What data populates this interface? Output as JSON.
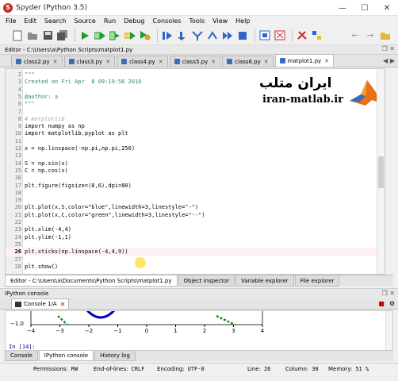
{
  "window": {
    "title": "Spyder (Python 3.5)"
  },
  "window_controls": {
    "minimize": "—",
    "maximize": "☐",
    "close": "✕"
  },
  "menu": [
    "File",
    "Edit",
    "Search",
    "Source",
    "Run",
    "Debug",
    "Consoles",
    "Tools",
    "View",
    "Help"
  ],
  "toolbar_icons": [
    "new-file-icon",
    "open-file-icon",
    "save-icon",
    "save-all-icon",
    "run-icon",
    "run-cell-icon",
    "run-cell-advance-icon",
    "run-selection-icon",
    "run-config-icon",
    "debug-icon",
    "step-icon",
    "step-into-icon",
    "step-return-icon",
    "continue-icon",
    "stop-debug-icon",
    "maximize-pane-icon",
    "fullscreen-icon",
    "preferences-icon",
    "python-path-icon",
    "back-icon",
    "forward-icon",
    "browse-folder-icon"
  ],
  "editor": {
    "title": "Editor - C:\\Users\\a\\Python Scripts\\matplot1.py",
    "tabs": [
      {
        "label": "class2.py",
        "active": false
      },
      {
        "label": "class3.py",
        "active": false
      },
      {
        "label": "class4.py",
        "active": false
      },
      {
        "label": "class5.py",
        "active": false
      },
      {
        "label": "class6.py",
        "active": false
      },
      {
        "label": "matplot1.py",
        "active": true
      }
    ],
    "current_line": 26,
    "lines": [
      {
        "n": "2",
        "t": "\"\"\"",
        "cls": "c-str"
      },
      {
        "n": "3",
        "t": "Created on Fri Apr  8 09:19:56 2016",
        "cls": "c-str"
      },
      {
        "n": "4",
        "t": "",
        "cls": "c-str"
      },
      {
        "n": "5",
        "t": "@author: a",
        "cls": "c-str"
      },
      {
        "n": "6",
        "t": "\"\"\"",
        "cls": "c-str"
      },
      {
        "n": "7",
        "t": "",
        "cls": "c-def"
      },
      {
        "n": "8",
        "t": "# matplotlib",
        "cls": "c-cmt"
      },
      {
        "n": "9",
        "t": "import numpy as np",
        "cls": "c-def"
      },
      {
        "n": "10",
        "t": "import matplotlib.pyplot as plt",
        "cls": "c-def"
      },
      {
        "n": "11",
        "t": "",
        "cls": "c-def"
      },
      {
        "n": "12",
        "t": "x = np.linspace(-np.pi,np.pi,256)",
        "cls": "c-def"
      },
      {
        "n": "13",
        "t": "",
        "cls": "c-def"
      },
      {
        "n": "14",
        "t": "S = np.sin(x)",
        "cls": "c-def"
      },
      {
        "n": "15",
        "t": "C = np.cos(x)",
        "cls": "c-def"
      },
      {
        "n": "16",
        "t": "",
        "cls": "c-def"
      },
      {
        "n": "17",
        "t": "plt.figure(figsize=(8,6),dpi=80)",
        "cls": "c-def"
      },
      {
        "n": "18",
        "t": "",
        "cls": "c-def"
      },
      {
        "n": "19",
        "t": "",
        "cls": "c-def"
      },
      {
        "n": "20",
        "t": "plt.plot(x,S,color=\"blue\",linewidth=3,linestyle=\"-\")",
        "cls": "c-def"
      },
      {
        "n": "21",
        "t": "plt.plot(x,C,color=\"green\",linewidth=3,linestyle=\"--\")",
        "cls": "c-def"
      },
      {
        "n": "22",
        "t": "",
        "cls": "c-def"
      },
      {
        "n": "23",
        "t": "plt.xlim(-4,4)",
        "cls": "c-def"
      },
      {
        "n": "24",
        "t": "plt.ylim(-1,1)",
        "cls": "c-def"
      },
      {
        "n": "25",
        "t": "",
        "cls": "c-def"
      },
      {
        "n": "26",
        "t": "plt.xticks(np.linspace(-4,4,9))",
        "cls": "c-def"
      },
      {
        "n": "27",
        "t": "",
        "cls": "c-def"
      },
      {
        "n": "28",
        "t": "plt.show()",
        "cls": "c-def"
      }
    ]
  },
  "watermark": {
    "fa": "ایران متلب",
    "url": "iran-matlab.ir"
  },
  "bottom_tabs": [
    {
      "label": "Editor - C:\\Users\\a\\Documents\\Python Scripts\\matplot1.py",
      "active": true
    },
    {
      "label": "Object inspector",
      "active": false
    },
    {
      "label": "Variable explorer",
      "active": false
    },
    {
      "label": "File explorer",
      "active": false
    }
  ],
  "ipython": {
    "title": "IPython console",
    "console_tab": "Console 1/A",
    "prompt": "In [14]:",
    "inline_plot": {
      "ytick": "−1.0",
      "xticks": [
        "−4",
        "−3",
        "−2",
        "−1",
        "0",
        "1",
        "2",
        "3",
        "4"
      ]
    }
  },
  "console_bottom_tabs": [
    {
      "label": "Console",
      "active": false
    },
    {
      "label": "IPython console",
      "active": true
    },
    {
      "label": "History log",
      "active": false
    }
  ],
  "status": {
    "permissions_label": "Permissions:",
    "permissions": "RW",
    "eol_label": "End-of-lines:",
    "eol": "CRLF",
    "encoding_label": "Encoding:",
    "encoding": "UTF-8",
    "line_label": "Line:",
    "line": "26",
    "column_label": "Column:",
    "column": "30",
    "memory_label": "Memory:",
    "memory": "51 %"
  },
  "colors": {
    "sin_line": "#0000c8",
    "cos_line": "#228b22",
    "logo_orange": "#e8701a"
  }
}
